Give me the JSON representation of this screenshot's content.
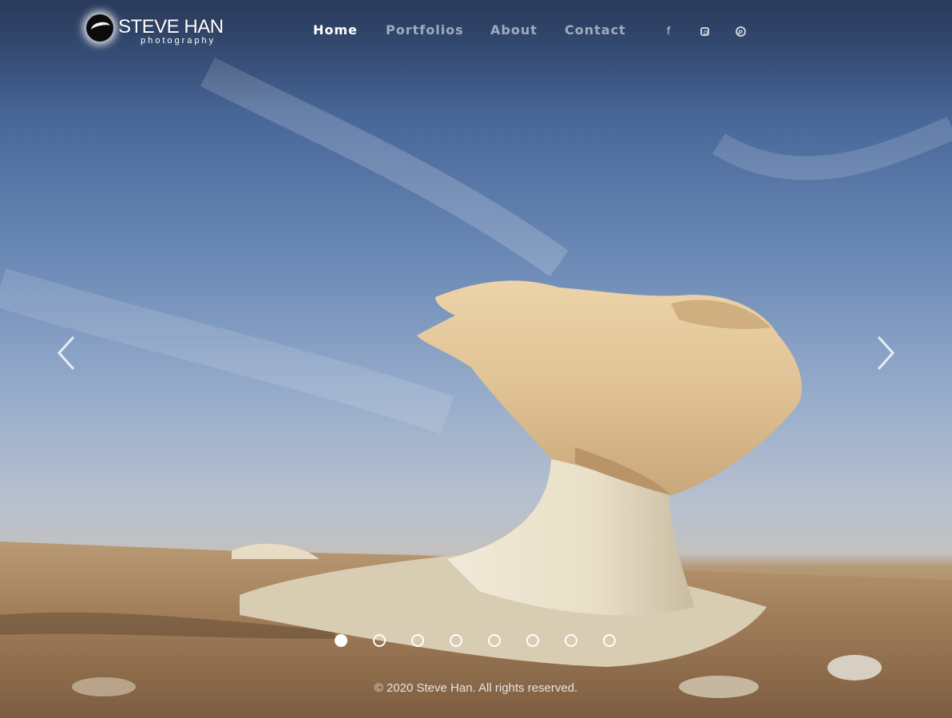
{
  "brand": {
    "name": "STEVE HAN",
    "tagline": "photography"
  },
  "nav": {
    "items": [
      {
        "label": "Home",
        "active": true
      },
      {
        "label": "Portfolios",
        "active": false
      },
      {
        "label": "About",
        "active": false
      },
      {
        "label": "Contact",
        "active": false
      }
    ]
  },
  "social": [
    {
      "name": "facebook-icon",
      "glyph": "f"
    },
    {
      "name": "instagram-icon"
    },
    {
      "name": "pinterest-icon",
      "glyph": "p"
    }
  ],
  "slideshow": {
    "slide_count": 8,
    "active_index": 0,
    "prev_icon": "chevron-left-icon",
    "next_icon": "chevron-right-icon"
  },
  "footer": {
    "copyright": "© 2020 Steve Han. All rights reserved."
  },
  "colors": {
    "nav_active": "#ffffff",
    "nav_inactive": "rgba(255,255,255,0.55)",
    "sky_top": "#334a75",
    "rock": "#e3c79a"
  }
}
